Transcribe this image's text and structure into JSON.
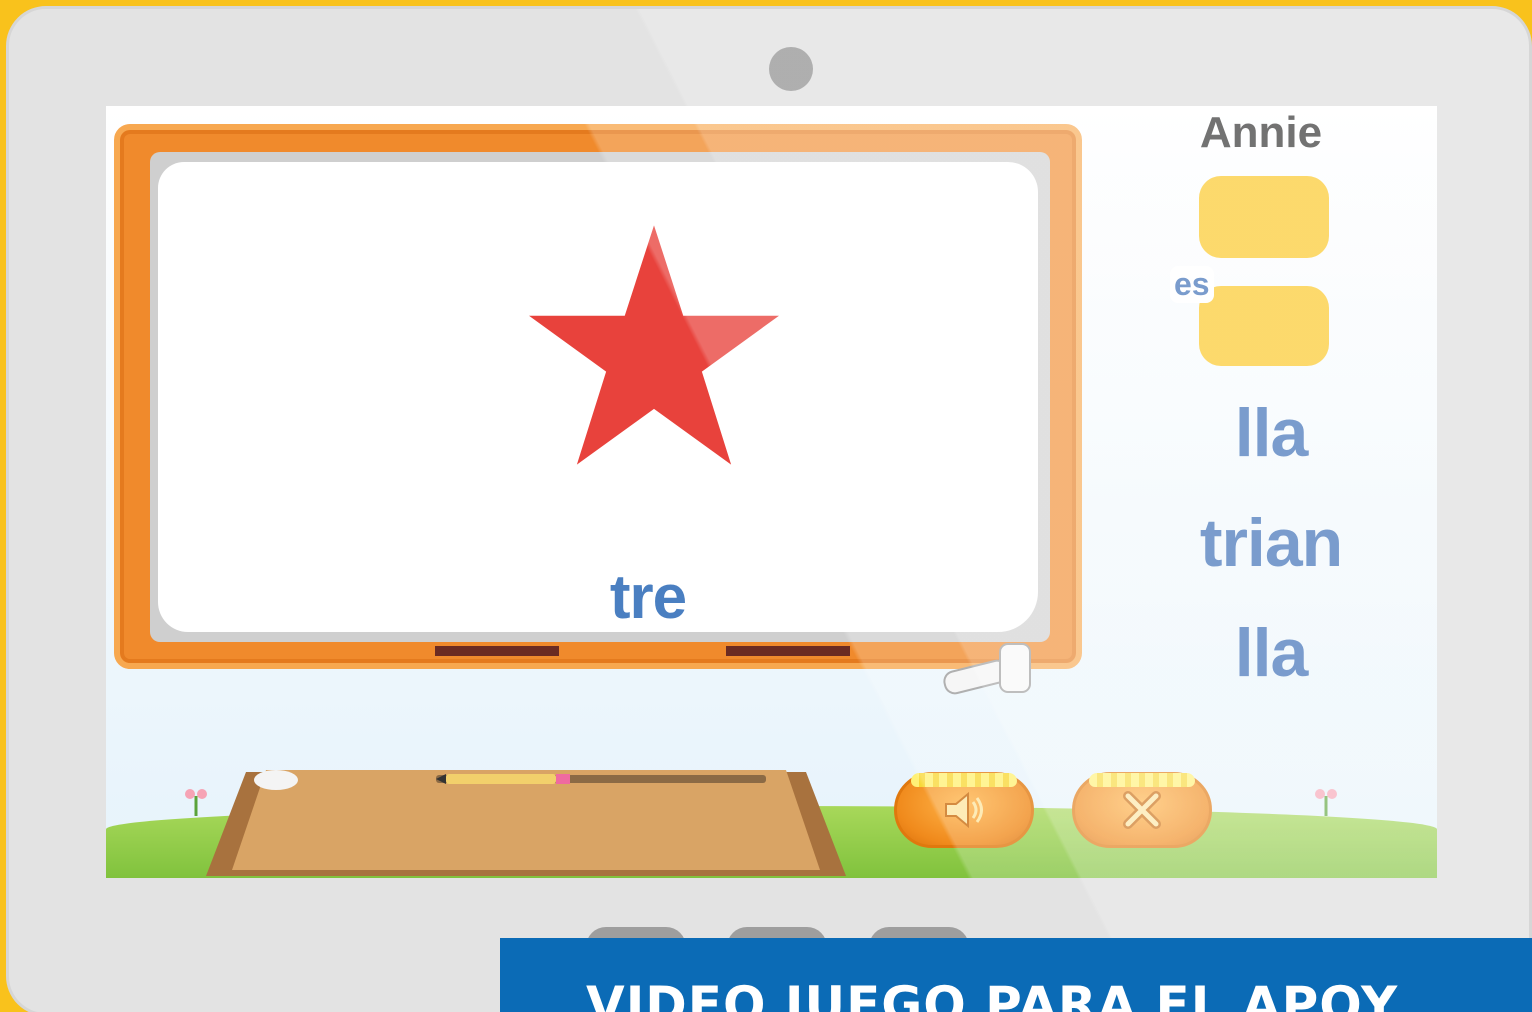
{
  "game": {
    "word_fragment": "tre",
    "player_name": "Annie",
    "answer_prefix": "es",
    "options": [
      "lla",
      "trian",
      "lla"
    ],
    "target_shape": "star-icon",
    "target_color": "#e8423c"
  },
  "controls": {
    "sound_icon": "speaker-icon",
    "close_icon": "close-icon"
  },
  "banner": {
    "text": "VIDEO JUEGO PARA EL APOY"
  },
  "colors": {
    "frame": "#f9c21c",
    "board": "#f08a2c",
    "slot": "#fbc419",
    "syllable": "#2f64b1",
    "banner": "#0b6bb6"
  }
}
